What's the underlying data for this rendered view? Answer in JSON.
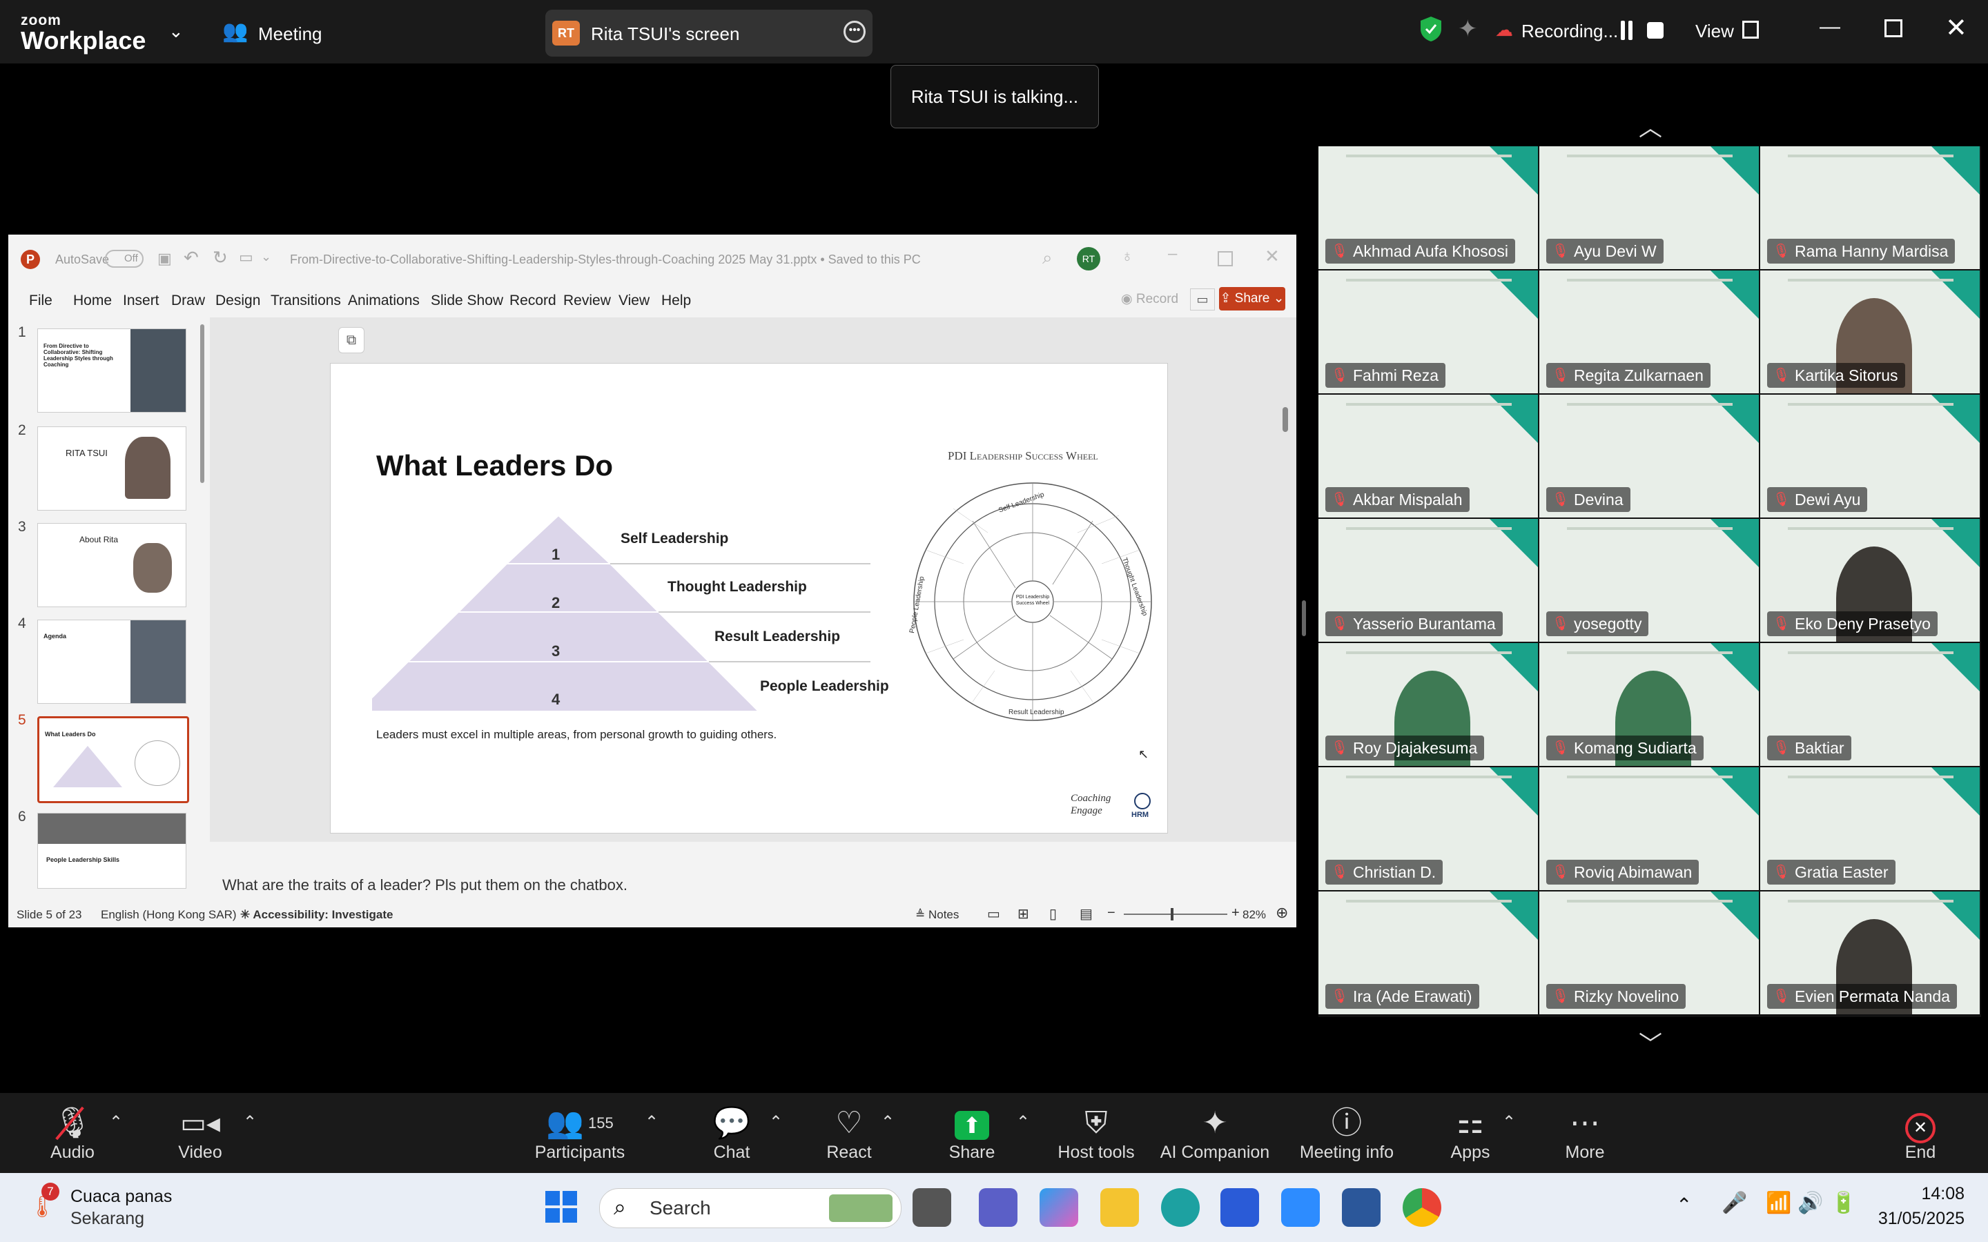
{
  "topbar": {
    "logo_small": "zoom",
    "logo_big": "Workplace",
    "meeting_label": "Meeting",
    "screen_share_badge": "RT",
    "screen_share_label": "Rita TSUI's screen",
    "recording_label": "Recording...",
    "view_label": "View"
  },
  "talking_indicator": "Rita TSUI is talking...",
  "ppt": {
    "autosave": "AutoSave",
    "autosave_state": "Off",
    "filename": "From-Directive-to-Collaborative-Shifting-Leadership-Styles-through-Coaching 2025 May 31.pptx • Saved to this PC",
    "user_initials": "RT",
    "menu": [
      "File",
      "Home",
      "Insert",
      "Draw",
      "Design",
      "Transitions",
      "Animations",
      "Slide Show",
      "Record",
      "Review",
      "View",
      "Help"
    ],
    "record_btn": "Record",
    "share_btn": "Share",
    "thumbnails": [
      {
        "num": "1",
        "title": "From Directive to Collaborative: Shifting Leadership Styles through Coaching"
      },
      {
        "num": "2",
        "title": "RITA TSUI"
      },
      {
        "num": "3",
        "title": "About Rita"
      },
      {
        "num": "4",
        "title": "Agenda"
      },
      {
        "num": "5",
        "title": "What Leaders Do"
      },
      {
        "num": "6",
        "title": "People Leadership Skills"
      }
    ],
    "slide": {
      "title": "What Leaders Do",
      "levels": [
        {
          "num": "1",
          "label": "Self Leadership"
        },
        {
          "num": "2",
          "label": "Thought Leadership"
        },
        {
          "num": "3",
          "label": "Result Leadership"
        },
        {
          "num": "4",
          "label": "People Leadership"
        }
      ],
      "caption": "Leaders must excel in multiple areas, from personal growth to guiding others.",
      "wheel_title": "PDI Leadership Success Wheel",
      "wheel_center": "PDI Leadership Success Wheel",
      "wheel_outer": [
        "Self Leadership",
        "Thought Leadership",
        "Result Leadership",
        "People Leadership"
      ],
      "brand_line1": "Coaching",
      "brand_line2": "Engage",
      "brand_right": "HRM"
    },
    "notes": "What are the traits of a leader? Pls put them on the chatbox.",
    "status": {
      "slide_of": "Slide 5 of 23",
      "language": "English (Hong Kong SAR)",
      "accessibility": "Accessibility: Investigate",
      "notes_btn": "Notes",
      "zoom": "82%"
    }
  },
  "gallery": {
    "participants": [
      {
        "name": "Akhmad Aufa Khososi"
      },
      {
        "name": "Ayu Devi W"
      },
      {
        "name": "Rama Hanny Mardisa"
      },
      {
        "name": "Fahmi Reza"
      },
      {
        "name": "Regita Zulkarnaen"
      },
      {
        "name": "Kartika Sitorus"
      },
      {
        "name": "Akbar Mispalah"
      },
      {
        "name": "Devina"
      },
      {
        "name": "Dewi Ayu"
      },
      {
        "name": "Yasserio Burantama"
      },
      {
        "name": "yosegotty"
      },
      {
        "name": "Eko Deny Prasetyo"
      },
      {
        "name": "Roy Djajakesuma"
      },
      {
        "name": "Komang Sudiarta"
      },
      {
        "name": "Baktiar"
      },
      {
        "name": "Christian D."
      },
      {
        "name": "Roviq Abimawan"
      },
      {
        "name": "Gratia Easter"
      },
      {
        "name": "Ira (Ade Erawati)"
      },
      {
        "name": "Rizky Novelino"
      },
      {
        "name": "Evien Permata Nanda"
      }
    ]
  },
  "toolbar": {
    "audio": "Audio",
    "video": "Video",
    "participants": "Participants",
    "participants_count": "155",
    "chat": "Chat",
    "react": "React",
    "share": "Share",
    "host_tools": "Host tools",
    "ai_companion": "AI Companion",
    "meeting_info": "Meeting info",
    "apps": "Apps",
    "more": "More",
    "end": "End"
  },
  "taskbar": {
    "weather_badge": "7",
    "weather_title": "Cuaca panas",
    "weather_sub": "Sekarang",
    "search": "Search",
    "time": "14:08",
    "date": "31/05/2025"
  },
  "colors": {
    "share_green": "#0fb34b",
    "end_red": "#e8303c",
    "ppt_red": "#c43e1c",
    "pyramid_fill": "#dcd6ea",
    "tile_teal": "#1aa28a"
  }
}
